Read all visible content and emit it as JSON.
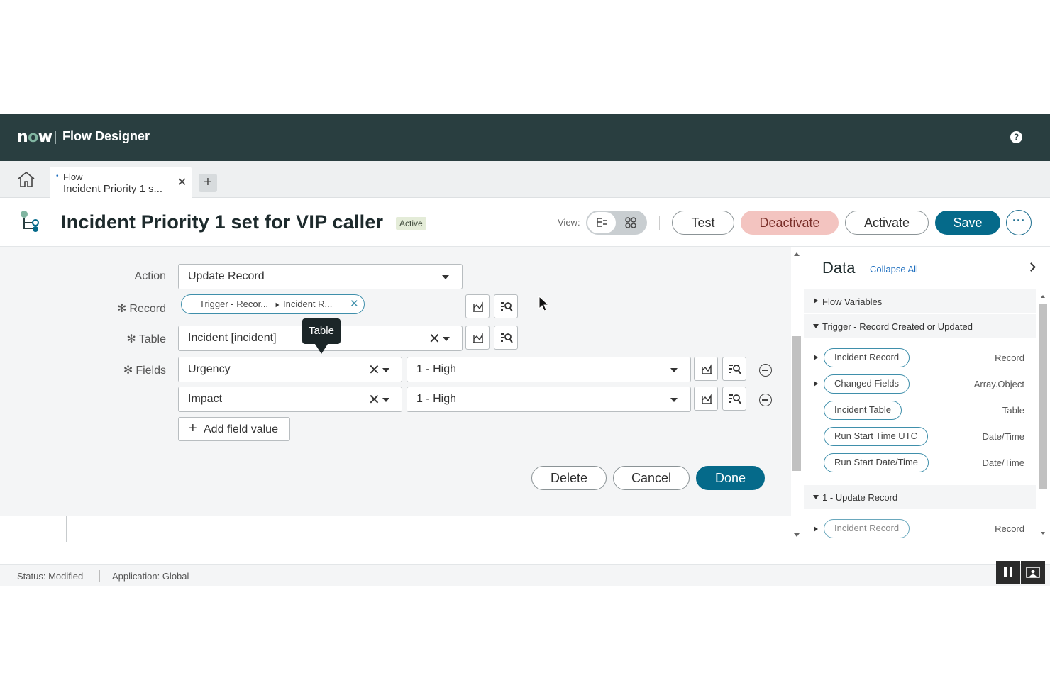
{
  "app": {
    "logo": "now",
    "name": "Flow Designer",
    "help_icon": "help-circle-icon"
  },
  "tabs": {
    "home_icon": "home-icon",
    "items": [
      {
        "type_label": "Flow",
        "title": "Incident Priority 1 s..."
      }
    ],
    "add_icon": "plus-icon"
  },
  "header": {
    "title": "Incident Priority 1 set for VIP caller",
    "status_badge": "Active",
    "view_label": "View:",
    "buttons": {
      "test": "Test",
      "deactivate": "Deactivate",
      "activate": "Activate",
      "save": "Save",
      "more": "···"
    }
  },
  "action_form": {
    "action_label": "Action",
    "action_value": "Update Record",
    "record_label": "Record",
    "record_pill": {
      "part1": "Trigger - Recor...",
      "part2": "Incident R..."
    },
    "table_label": "Table",
    "table_value": "Incident [incident]",
    "table_tooltip": "Table",
    "fields_label": "Fields",
    "fields": [
      {
        "field": "Urgency",
        "value": "1 - High"
      },
      {
        "field": "Impact",
        "value": "1 - High"
      }
    ],
    "add_field_value": "Add field value",
    "buttons": {
      "delete": "Delete",
      "cancel": "Cancel",
      "done": "Done"
    }
  },
  "data_panel": {
    "title": "Data",
    "collapse_all": "Collapse All",
    "groups": [
      {
        "label": "Flow Variables",
        "expanded": false
      },
      {
        "label": "Trigger - Record Created or Updated",
        "expanded": true
      },
      {
        "label": "1 - Update Record",
        "expanded": true
      }
    ],
    "trigger_items": [
      {
        "label": "Incident Record",
        "type": "Record",
        "expandable": true
      },
      {
        "label": "Changed Fields",
        "type": "Array.Object",
        "expandable": true
      },
      {
        "label": "Incident Table",
        "type": "Table",
        "expandable": false
      },
      {
        "label": "Run Start Time UTC",
        "type": "Date/Time",
        "expandable": false
      },
      {
        "label": "Run Start Date/Time",
        "type": "Date/Time",
        "expandable": false
      }
    ],
    "update_items": [
      {
        "label": "Incident Record",
        "type": "Record",
        "expandable": true
      }
    ]
  },
  "status_bar": {
    "status": "Status: Modified",
    "application": "Application: Global"
  }
}
